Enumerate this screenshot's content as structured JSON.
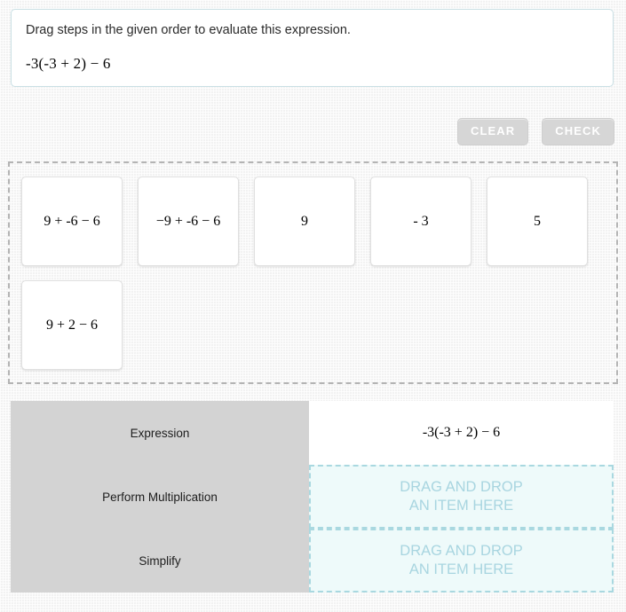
{
  "prompt": {
    "instruction": "Drag steps in the given order to evaluate this expression.",
    "expression": "-3(-3 + 2) − 6"
  },
  "toolbar": {
    "clear_label": "CLEAR",
    "check_label": "CHECK"
  },
  "tile_bank": {
    "tiles": [
      {
        "text": "9 + -6 − 6"
      },
      {
        "text": "−9 + -6 − 6"
      },
      {
        "text": "9"
      },
      {
        "text": "- 3"
      },
      {
        "text": "5"
      },
      {
        "text": "9 + 2 − 6"
      }
    ]
  },
  "steps_table": {
    "rows": [
      {
        "label": "Expression",
        "value": "-3(-3 + 2) − 6",
        "filled": true
      },
      {
        "label": "Perform Multiplication",
        "placeholder_line1": "DRAG AND DROP",
        "placeholder_line2": "AN ITEM HERE",
        "filled": false
      },
      {
        "label": "Simplify",
        "placeholder_line1": "DRAG AND DROP",
        "placeholder_line2": "AN ITEM HERE",
        "filled": false
      }
    ]
  },
  "colors": {
    "page_background": "#f2f2f2",
    "card_border": "#c9dfe4",
    "button_background": "#d6d6d6",
    "bank_border": "#b4b4b4",
    "label_cell": "#d3d3d3",
    "dropzone_background": "#eefafa",
    "dropzone_border": "#a9d8e0",
    "dropzone_text": "#a8d5e0"
  }
}
